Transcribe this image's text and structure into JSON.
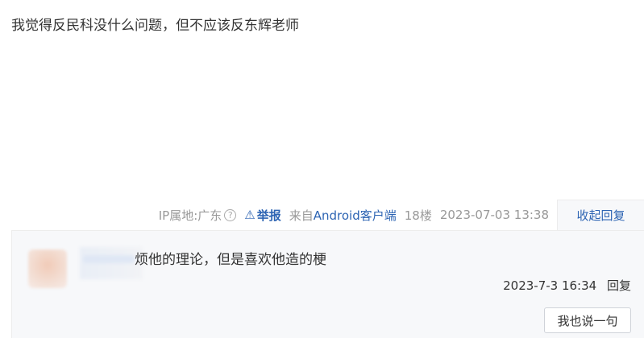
{
  "post": {
    "content": "我觉得反民科没什么问题，但不应该反东辉老师"
  },
  "meta": {
    "ip_location": "IP属地:广东",
    "ip_help_glyph": "?",
    "report_glyph": "⚠",
    "report_label": "举报",
    "client_prefix": "来自",
    "client_name": "Android客户端",
    "floor": "18楼",
    "timestamp": "2023-07-03 13:38",
    "collapse_label": "收起回复"
  },
  "reply": {
    "text": "烦他的理论，但是喜欢他造的梗",
    "time": "2023-7-3 16:34",
    "reply_label": "回复"
  },
  "actions": {
    "say_button": "我也说一句"
  }
}
